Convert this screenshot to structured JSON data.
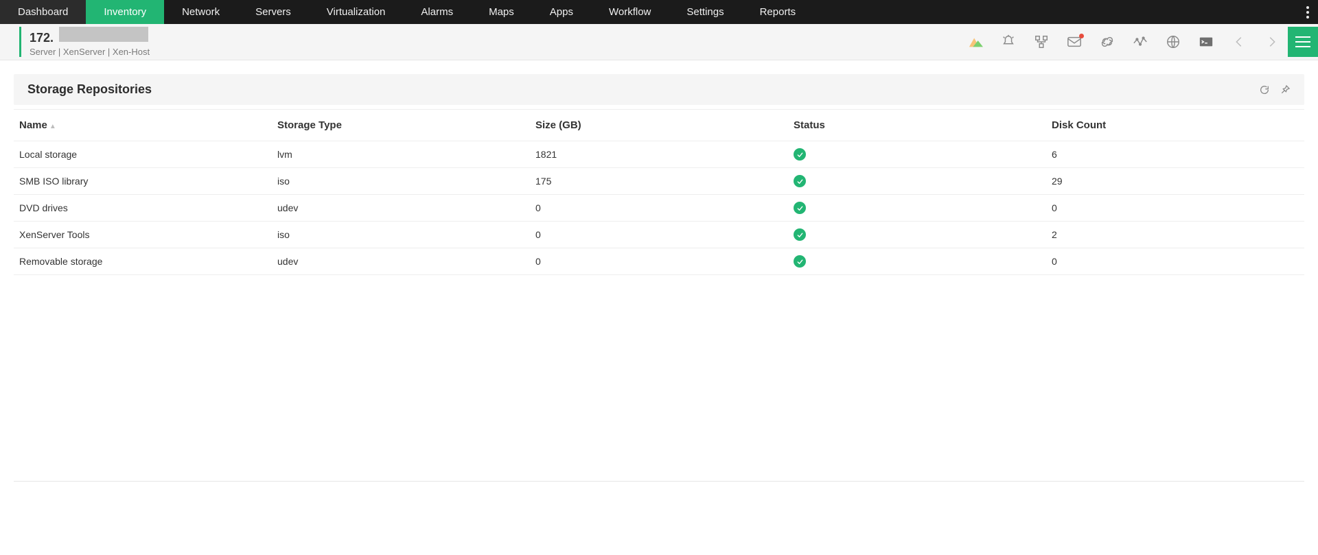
{
  "nav": {
    "items": [
      {
        "label": "Dashboard",
        "active": false
      },
      {
        "label": "Inventory",
        "active": true
      },
      {
        "label": "Network",
        "active": false
      },
      {
        "label": "Servers",
        "active": false
      },
      {
        "label": "Virtualization",
        "active": false
      },
      {
        "label": "Alarms",
        "active": false
      },
      {
        "label": "Maps",
        "active": false
      },
      {
        "label": "Apps",
        "active": false
      },
      {
        "label": "Workflow",
        "active": false
      },
      {
        "label": "Settings",
        "active": false
      },
      {
        "label": "Reports",
        "active": false
      }
    ]
  },
  "subheader": {
    "title_prefix": "172.",
    "breadcrumbs": "Server  | XenServer   | Xen-Host",
    "icons": {
      "chart": "chart-icon",
      "alerts": "alerts-icon",
      "topology": "topology-icon",
      "mail": "mail-icon",
      "link": "link-icon",
      "activity": "activity-icon",
      "globe": "globe-icon",
      "terminal": "terminal-icon",
      "prev": "chevron-left-icon",
      "next": "chevron-right-icon",
      "menu": "hamburger-icon"
    }
  },
  "panel": {
    "title": "Storage Repositories",
    "actions": {
      "refresh": "refresh-icon",
      "pin": "pin-icon"
    },
    "columns": {
      "name": "Name",
      "storage_type": "Storage Type",
      "size": "Size (GB)",
      "status": "Status",
      "disk_count": "Disk Count"
    },
    "rows": [
      {
        "name": "Local storage",
        "storage_type": "lvm",
        "size": "1821",
        "status": "ok",
        "disk_count": "6"
      },
      {
        "name": "SMB ISO library",
        "storage_type": "iso",
        "size": "175",
        "status": "ok",
        "disk_count": "29"
      },
      {
        "name": "DVD drives",
        "storage_type": "udev",
        "size": "0",
        "status": "ok",
        "disk_count": "0"
      },
      {
        "name": "XenServer Tools",
        "storage_type": "iso",
        "size": "0",
        "status": "ok",
        "disk_count": "2"
      },
      {
        "name": "Removable storage",
        "storage_type": "udev",
        "size": "0",
        "status": "ok",
        "disk_count": "0"
      }
    ]
  }
}
